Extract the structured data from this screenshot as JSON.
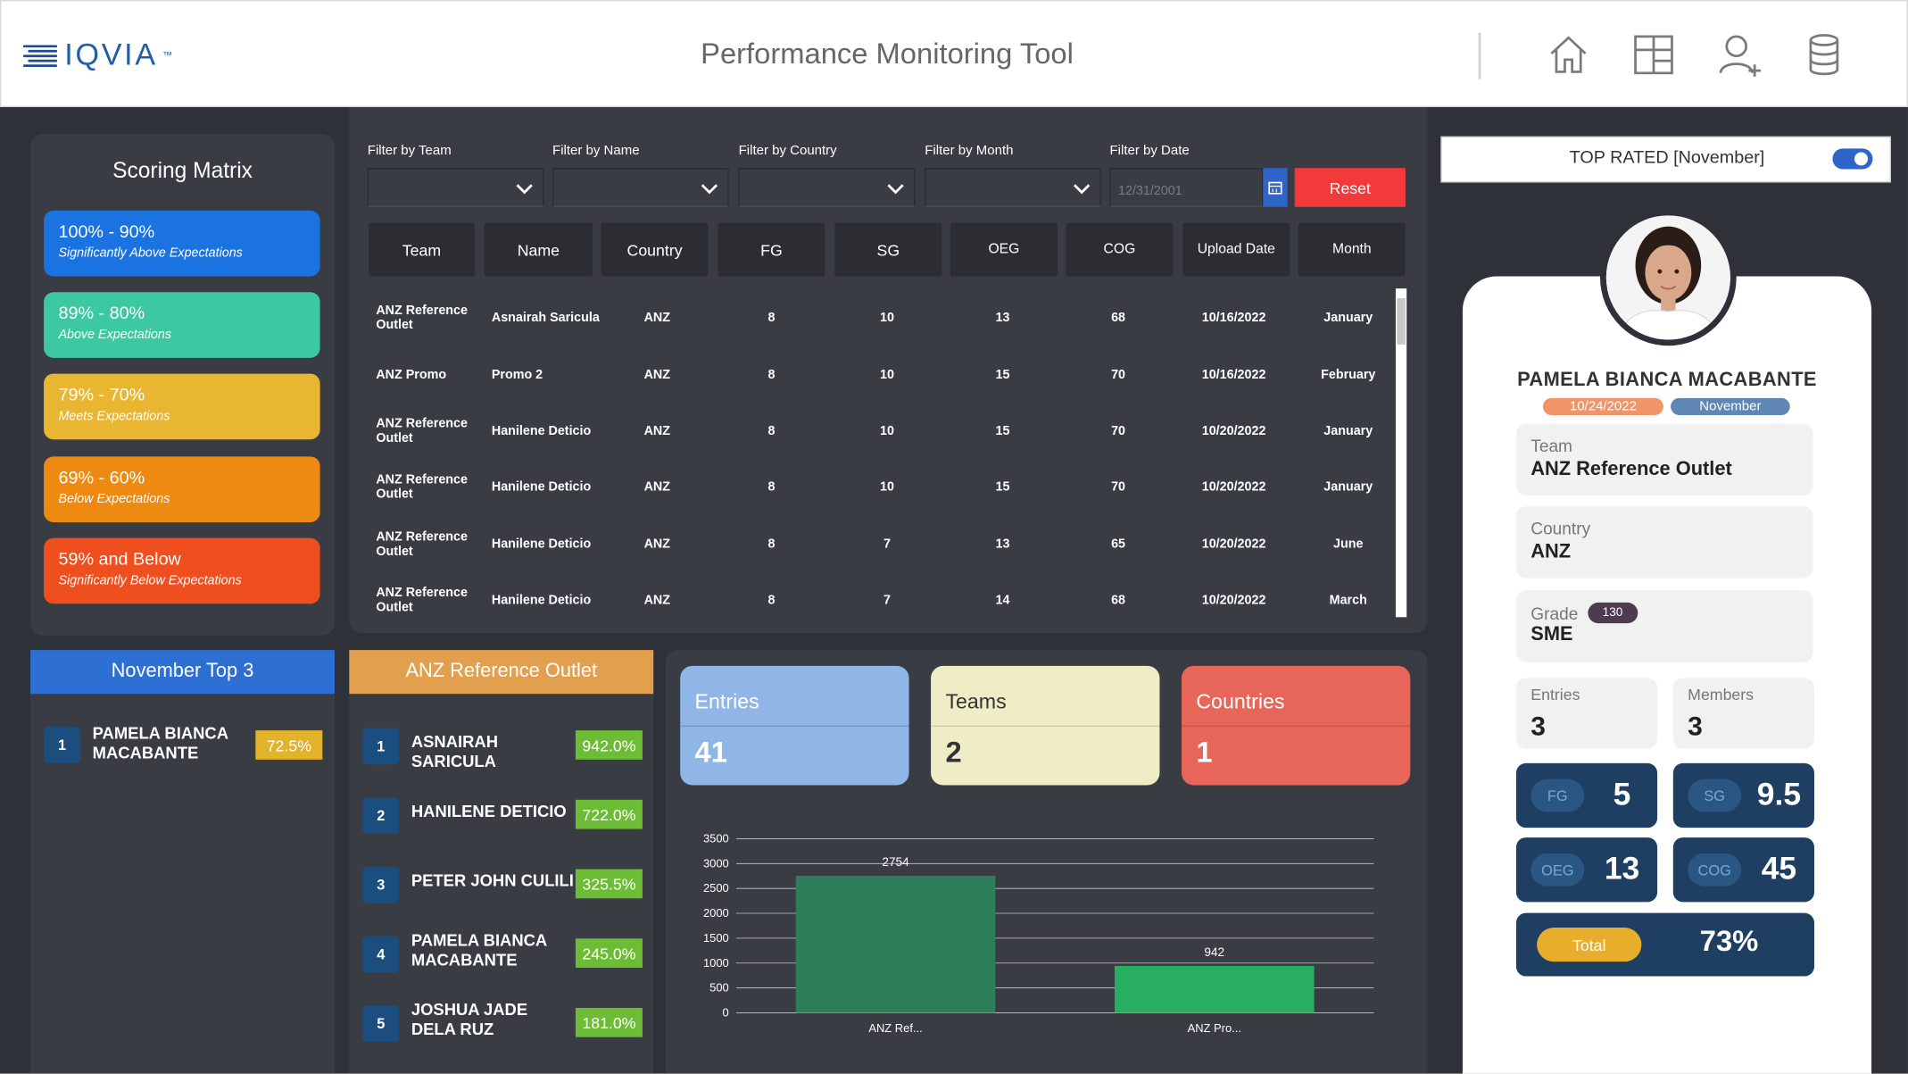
{
  "header": {
    "logo_text": "IQVIA",
    "logo_tm": "™",
    "title": "Performance Monitoring Tool",
    "icons": [
      "home-icon",
      "layout-icon",
      "add-user-icon",
      "database-icon"
    ]
  },
  "scoring_matrix": {
    "title": "Scoring Matrix",
    "items": [
      {
        "range": "100% - 90%",
        "desc": "Significantly Above Expectations",
        "color": "#1a73e0"
      },
      {
        "range": "89% - 80%",
        "desc": "Above Expectations",
        "color": "#3cc8a0"
      },
      {
        "range": "79% - 70%",
        "desc": "Meets Expectations",
        "color": "#e8b631"
      },
      {
        "range": "69% - 60%",
        "desc": "Below Expectations",
        "color": "#ee8a12"
      },
      {
        "range": "59% and Below",
        "desc": "Significantly Below Expectations",
        "color": "#ef4f1e"
      }
    ]
  },
  "filters": {
    "team": "Filter by Team",
    "name": "Filter by Name",
    "country": "Filter by Country",
    "month": "Filter by Month",
    "date": "Filter by Date",
    "date_placeholder": "12/31/2001",
    "reset": "Reset"
  },
  "table": {
    "columns": [
      "Team",
      "Name",
      "Country",
      "FG",
      "SG",
      "OEG",
      "COG",
      "Upload Date",
      "Month"
    ],
    "rows": [
      [
        "ANZ Reference Outlet",
        "Asnairah Saricula",
        "ANZ",
        "8",
        "10",
        "13",
        "68",
        "10/16/2022",
        "January"
      ],
      [
        "ANZ Promo",
        "Promo 2",
        "ANZ",
        "8",
        "10",
        "15",
        "70",
        "10/16/2022",
        "February"
      ],
      [
        "ANZ Reference Outlet",
        "Hanilene Deticio",
        "ANZ",
        "8",
        "10",
        "15",
        "70",
        "10/20/2022",
        "January"
      ],
      [
        "ANZ Reference Outlet",
        "Hanilene Deticio",
        "ANZ",
        "8",
        "10",
        "15",
        "70",
        "10/20/2022",
        "January"
      ],
      [
        "ANZ Reference Outlet",
        "Hanilene Deticio",
        "ANZ",
        "8",
        "7",
        "13",
        "65",
        "10/20/2022",
        "June"
      ],
      [
        "ANZ Reference Outlet",
        "Hanilene Deticio",
        "ANZ",
        "8",
        "7",
        "14",
        "68",
        "10/20/2022",
        "March"
      ]
    ]
  },
  "top3": {
    "title": "November Top 3",
    "items": [
      {
        "rank": "1",
        "name": "PAMELA BIANCA MACABANTE",
        "pct": "72.5%"
      }
    ]
  },
  "team_ranking": {
    "title": "ANZ Reference Outlet",
    "items": [
      {
        "rank": "1",
        "name": "ASNAIRAH SARICULA",
        "pct": "942.0%"
      },
      {
        "rank": "2",
        "name": "HANILENE DETICIO",
        "pct": "722.0%"
      },
      {
        "rank": "3",
        "name": "PETER JOHN CULILI",
        "pct": "325.5%"
      },
      {
        "rank": "4",
        "name": "PAMELA BIANCA MACABANTE",
        "pct": "245.0%"
      },
      {
        "rank": "5",
        "name": "JOSHUA JADE DELA RUZ",
        "pct": "181.0%"
      }
    ]
  },
  "kpis": [
    {
      "label": "Entries",
      "value": "41",
      "color": "#8fb6e6",
      "text_color": "#ffffff"
    },
    {
      "label": "Teams",
      "value": "2",
      "color": "#efedc6",
      "text_color": "#333333"
    },
    {
      "label": "Countries",
      "value": "1",
      "color": "#e8655a",
      "text_color": "#ffffff"
    }
  ],
  "chart_data": {
    "type": "bar",
    "categories": [
      "ANZ Ref...",
      "ANZ Pro..."
    ],
    "values": [
      2754,
      942
    ],
    "data_labels": [
      "2754",
      "942"
    ],
    "colors": [
      "#2e7d5b",
      "#27ae60"
    ],
    "ylim": [
      0,
      3500
    ],
    "yticks": [
      0,
      500,
      1000,
      1500,
      2000,
      2500,
      3000,
      3500
    ],
    "grid": true
  },
  "profile": {
    "header": "TOP RATED [November]",
    "toggle_on": true,
    "name": "PAMELA BIANCA MACABANTE",
    "date": "10/24/2022",
    "month": "November",
    "team_label": "Team",
    "team": "ANZ Reference Outlet",
    "country_label": "Country",
    "country": "ANZ",
    "grade_label": "Grade",
    "grade_badge": "130",
    "grade": "SME",
    "entries_label": "Entries",
    "entries": "3",
    "members_label": "Members",
    "members": "3",
    "scores": [
      {
        "label": "FG",
        "value": "5"
      },
      {
        "label": "SG",
        "value": "9.5"
      },
      {
        "label": "OEG",
        "value": "13"
      },
      {
        "label": "COG",
        "value": "45"
      }
    ],
    "total_label": "Total",
    "total": "73%"
  }
}
